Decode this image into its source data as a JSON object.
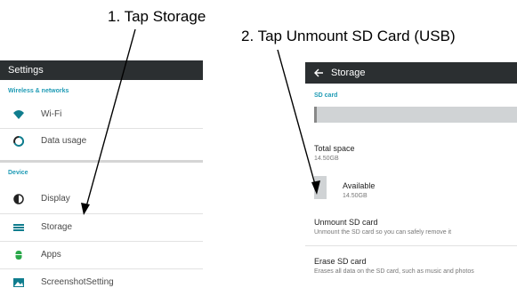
{
  "annotations": {
    "step1": "1. Tap Storage",
    "step2": "2. Tap Unmount SD Card (USB)"
  },
  "left_panel": {
    "title": "Settings",
    "sections": [
      {
        "header": "Wireless & networks"
      },
      {
        "header": "Device"
      }
    ],
    "items": [
      {
        "label": "Wi-Fi",
        "icon": "wifi-icon"
      },
      {
        "label": "Data usage",
        "icon": "data-usage-icon"
      },
      {
        "label": "Display",
        "icon": "display-icon"
      },
      {
        "label": "Storage",
        "icon": "storage-icon"
      },
      {
        "label": "Apps",
        "icon": "apps-icon"
      },
      {
        "label": "ScreenshotSetting",
        "icon": "screenshot-icon"
      }
    ]
  },
  "right_panel": {
    "title": "Storage",
    "back_icon": "back-arrow-icon",
    "section": "SD card",
    "total_space": {
      "label": "Total space",
      "value": "14.50GB"
    },
    "available": {
      "label": "Available",
      "value": "14.50GB"
    },
    "unmount": {
      "label": "Unmount SD card",
      "desc": "Unmount the SD card so you can safely remove it"
    },
    "erase": {
      "label": "Erase SD card",
      "desc": "Erases all data on the SD card, such as music and photos"
    }
  },
  "colors": {
    "toolbar": "#2b2f31",
    "accent": "#1f9bb5",
    "wifi_icon": "#0f7d8e",
    "divider": "#e2e2e2"
  }
}
